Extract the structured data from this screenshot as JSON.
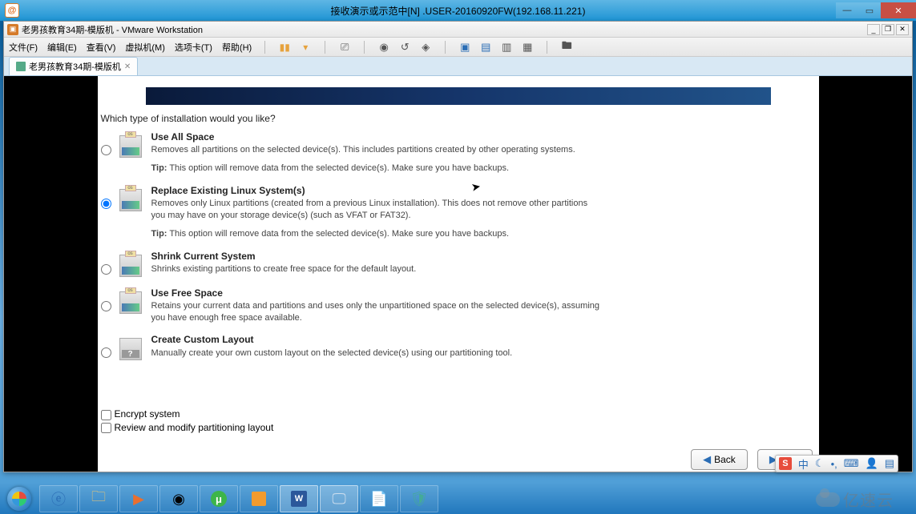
{
  "outer_title": "接收演示或示范中[N] .USER-20160920FW(192.168.11.221)",
  "vmw": {
    "title": "老男孩教育34期-模版机 - VMware Workstation",
    "menus": [
      "文件(F)",
      "编辑(E)",
      "查看(V)",
      "虚拟机(M)",
      "选项卡(T)",
      "帮助(H)"
    ],
    "tab": "老男孩教育34期-模版机"
  },
  "installer": {
    "prompt": "Which type of installation would you like?",
    "options": [
      {
        "title": "Use All Space",
        "desc": "Removes all partitions on the selected device(s).  This includes partitions created by other operating systems.",
        "tip": "This option will remove data from the selected device(s).  Make sure you have backups.",
        "checked": false
      },
      {
        "title": "Replace Existing Linux System(s)",
        "desc": "Removes only Linux partitions (created from a previous Linux installation).  This does not remove other partitions you may have on your storage device(s) (such as VFAT or FAT32).",
        "tip": "This option will remove data from the selected device(s).  Make sure you have backups.",
        "checked": true
      },
      {
        "title": "Shrink Current System",
        "desc": "Shrinks existing partitions to create free space for the default layout.",
        "tip": "",
        "checked": false
      },
      {
        "title": "Use Free Space",
        "desc": "Retains your current data and partitions and uses only the unpartitioned space on the selected device(s), assuming you have enough free space available.",
        "tip": "",
        "checked": false
      },
      {
        "title": "Create Custom Layout",
        "desc": "Manually create your own custom layout on the selected device(s) using our partitioning tool.",
        "tip": "",
        "checked": false
      }
    ],
    "checks": {
      "encrypt": "Encrypt system",
      "review": "Review and modify partitioning layout"
    },
    "back": "Back",
    "next": "Next",
    "tip_label": "Tip:"
  },
  "ime": {
    "mode": "中"
  },
  "watermark": "亿速云"
}
